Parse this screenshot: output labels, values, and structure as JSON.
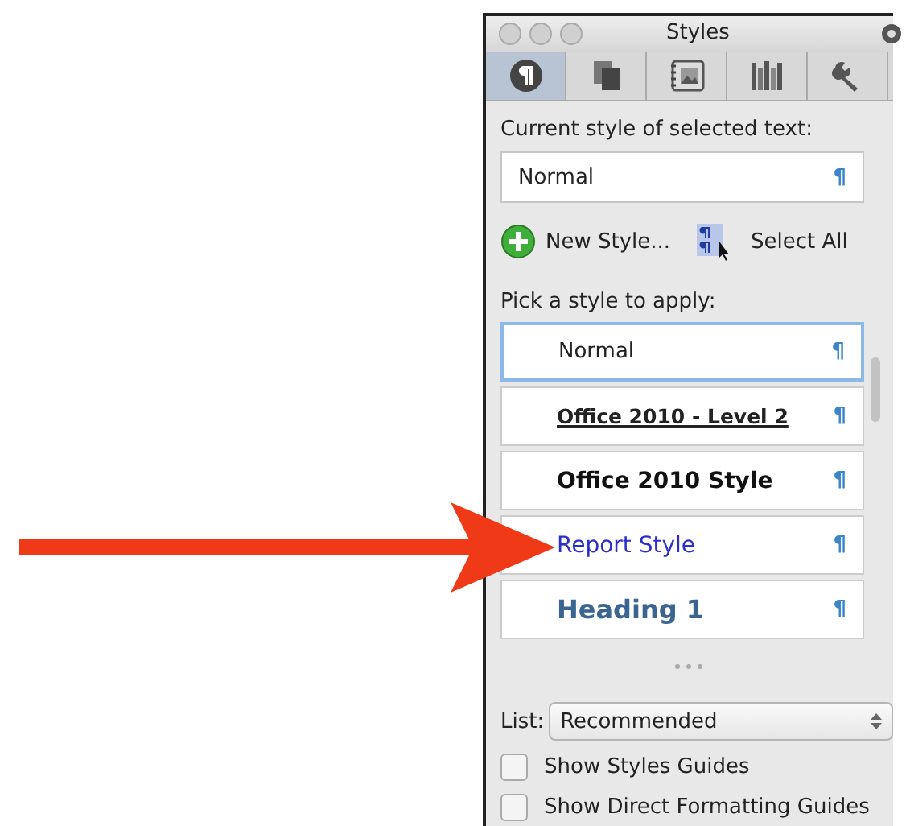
{
  "window": {
    "title": "Styles"
  },
  "tabs": [
    {
      "kind": "pilcrow",
      "selected": true
    },
    {
      "kind": "pages",
      "selected": false
    },
    {
      "kind": "picture",
      "selected": false
    },
    {
      "kind": "books",
      "selected": false
    },
    {
      "kind": "wrench",
      "selected": false
    }
  ],
  "current_style": {
    "label": "Current style of selected text:",
    "value": "Normal",
    "mark": "¶"
  },
  "actions": {
    "new_style": "New Style...",
    "select_all": "Select All"
  },
  "style_list": {
    "label": "Pick a style to apply:",
    "items": [
      {
        "name": "Normal",
        "kind": "plain",
        "mark": "¶",
        "selected": true
      },
      {
        "name": "Office 2010 - Level 2",
        "kind": "underlined",
        "mark": "¶",
        "selected": false
      },
      {
        "name": "Office 2010 Style",
        "kind": "bold",
        "mark": "¶",
        "selected": false
      },
      {
        "name": "Report Style",
        "kind": "colored",
        "mark": "¶",
        "selected": false
      },
      {
        "name": "Heading 1",
        "kind": "heading",
        "mark": "¶",
        "selected": false
      }
    ]
  },
  "list_filter": {
    "label": "List:",
    "value": "Recommended"
  },
  "options": [
    {
      "label": "Show Styles Guides",
      "checked": false
    },
    {
      "label": "Show Direct Formatting Guides",
      "checked": false
    }
  ]
}
